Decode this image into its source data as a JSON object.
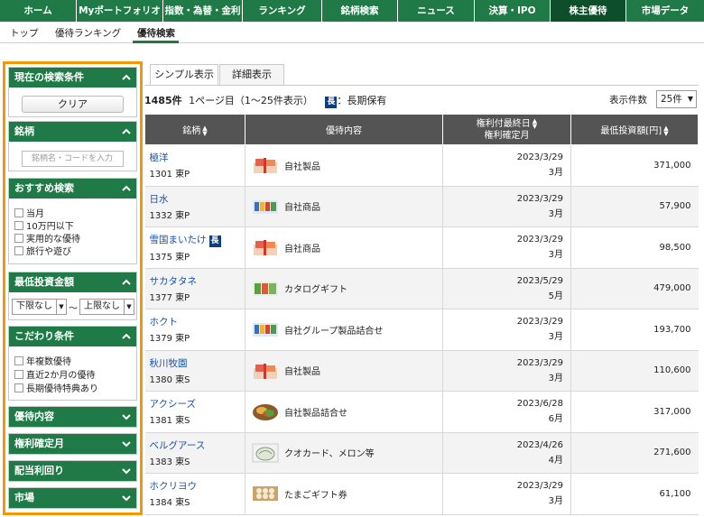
{
  "topnav": [
    "ホーム",
    "Myポートフォリオ",
    "指数・為替・金利",
    "ランキング",
    "銘柄検索",
    "ニュース",
    "決算・IPO",
    "株主優待",
    "市場データ"
  ],
  "subnav": [
    "トップ",
    "優待ランキング",
    "優待検索"
  ],
  "sidebar": {
    "current": {
      "title": "現在の検索条件",
      "clear": "クリア"
    },
    "brand": {
      "title": "銘柄",
      "placeholder": "銘柄名・コードを入力"
    },
    "recommend": {
      "title": "おすすめ検索",
      "options": [
        "当月",
        "10万円以下",
        "実用的な優待",
        "旅行や遊び"
      ]
    },
    "min_invest": {
      "title": "最低投資金額",
      "lower": "下限なし",
      "sep": "〜",
      "upper": "上限なし"
    },
    "detail": {
      "title": "こだわり条件",
      "options": [
        "年複数優待",
        "直近2か月の優待",
        "長期優待特典あり"
      ]
    },
    "collapsed": [
      "優待内容",
      "権利確定月",
      "配当利回り",
      "市場"
    ]
  },
  "tabs": [
    "シンプル表示",
    "詳細表示"
  ],
  "summary": {
    "count": "1485件",
    "page": "1ページ目（1〜25件表示）",
    "badge": "長",
    "badge_label": "：長期保有",
    "per_page_label": "表示件数",
    "per_page": "25件"
  },
  "table": {
    "headers": [
      "銘柄",
      "優待内容",
      "権利付最終日",
      "権利確定月",
      "最低投資額[円]"
    ],
    "rows": [
      {
        "name": "極洋",
        "code": "1301 東P",
        "long": false,
        "icon": "gift-box-icon",
        "yutai": "自社製品",
        "date": "2023/3/29",
        "month": "3月",
        "min": "371,000"
      },
      {
        "name": "日水",
        "code": "1332 東P",
        "long": false,
        "icon": "product-set-icon",
        "yutai": "自社商品",
        "date": "2023/3/29",
        "month": "3月",
        "min": "57,900"
      },
      {
        "name": "雪国まいたけ",
        "code": "1375 東P",
        "long": true,
        "icon": "gift-box-icon",
        "yutai": "自社商品",
        "date": "2023/3/29",
        "month": "3月",
        "min": "98,500"
      },
      {
        "name": "サカタタネ",
        "code": "1377 東P",
        "long": false,
        "icon": "catalog-icon",
        "yutai": "カタログギフト",
        "date": "2023/5/29",
        "month": "5月",
        "min": "479,000"
      },
      {
        "name": "ホクト",
        "code": "1379 東P",
        "long": false,
        "icon": "product-set-icon",
        "yutai": "自社グループ製品詰合せ",
        "date": "2023/3/29",
        "month": "3月",
        "min": "193,700"
      },
      {
        "name": "秋川牧園",
        "code": "1380 東S",
        "long": false,
        "icon": "gift-box-icon",
        "yutai": "自社製品",
        "date": "2023/3/29",
        "month": "3月",
        "min": "110,600"
      },
      {
        "name": "アクシーズ",
        "code": "1381 東S",
        "long": false,
        "icon": "food-plate-icon",
        "yutai": "自社製品詰合せ",
        "date": "2023/6/28",
        "month": "6月",
        "min": "317,000"
      },
      {
        "name": "ベルグアース",
        "code": "1383 東S",
        "long": false,
        "icon": "melon-icon",
        "yutai": "クオカード、メロン等",
        "date": "2023/4/26",
        "month": "4月",
        "min": "271,600"
      },
      {
        "name": "ホクリヨウ",
        "code": "1384 東S",
        "long": false,
        "icon": "egg-box-icon",
        "yutai": "たまごギフト券",
        "date": "2023/3/29",
        "month": "3月",
        "min": "61,100"
      }
    ]
  },
  "colors": {
    "brand_green": "#1f7a47",
    "active_nav": "#0c4f2a",
    "highlight_border": "#f39800",
    "link": "#1a4ea1",
    "table_header": "#545454",
    "long_badge": "#0e3f7a"
  }
}
